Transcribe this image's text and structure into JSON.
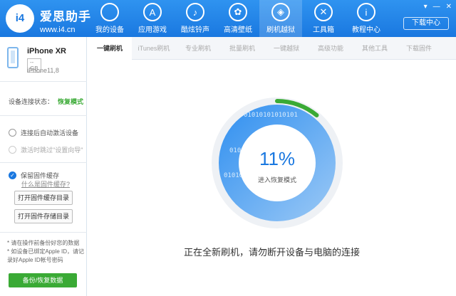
{
  "brand": {
    "logo_text": "i4",
    "name": "爱思助手",
    "url": "www.i4.cn"
  },
  "nav": [
    {
      "label": "我的设备",
      "icon": "apple-icon",
      "glyph": ""
    },
    {
      "label": "应用游戏",
      "icon": "app-store-icon",
      "glyph": "A"
    },
    {
      "label": "酷炫铃声",
      "icon": "bell-icon",
      "glyph": "♪"
    },
    {
      "label": "高清壁纸",
      "icon": "flower-icon",
      "glyph": "✿"
    },
    {
      "label": "刷机越狱",
      "icon": "dropbox-icon",
      "glyph": "◈"
    },
    {
      "label": "工具箱",
      "icon": "tools-icon",
      "glyph": "✕"
    },
    {
      "label": "教程中心",
      "icon": "info-icon",
      "glyph": "i"
    }
  ],
  "download_center": "下载中心",
  "window_controls": {
    "a": "▾",
    "b": "—",
    "c": "✕"
  },
  "device": {
    "name": "iPhone XR",
    "capacity": "-- GB",
    "version": "iPhone11,8"
  },
  "sidebar": {
    "status_label": "设备连接状态：",
    "status_value": "恢复模式",
    "opt1": "连接后自动激活设备",
    "opt2": "激活时跳过\"设置向导\"",
    "opt3": "保留固件缓存",
    "link": "什么是固件缓存?",
    "btn1": "打开固件缓存目录",
    "btn2": "打开固件存储目录",
    "note1": "* 请在操作前备份好您的数据",
    "note2": "* 如设备已绑定Apple ID，请记录好Apple ID帐号密码",
    "backup": "备份/恢复数据"
  },
  "tabs": [
    "一键刷机",
    "iTunes刷机",
    "专业刷机",
    "批量刷机",
    "一键越狱",
    "高级功能",
    "其他工具",
    "下载固件"
  ],
  "progress": {
    "value": 0.11,
    "percent_text": "11%",
    "mode_text": "进入恢复模式",
    "binary_text": "01010101010101",
    "ring_color": "#3aaa35",
    "fill_color": "#1a78e0"
  },
  "message": "正在全新刷机，请勿断开设备与电脑的连接"
}
